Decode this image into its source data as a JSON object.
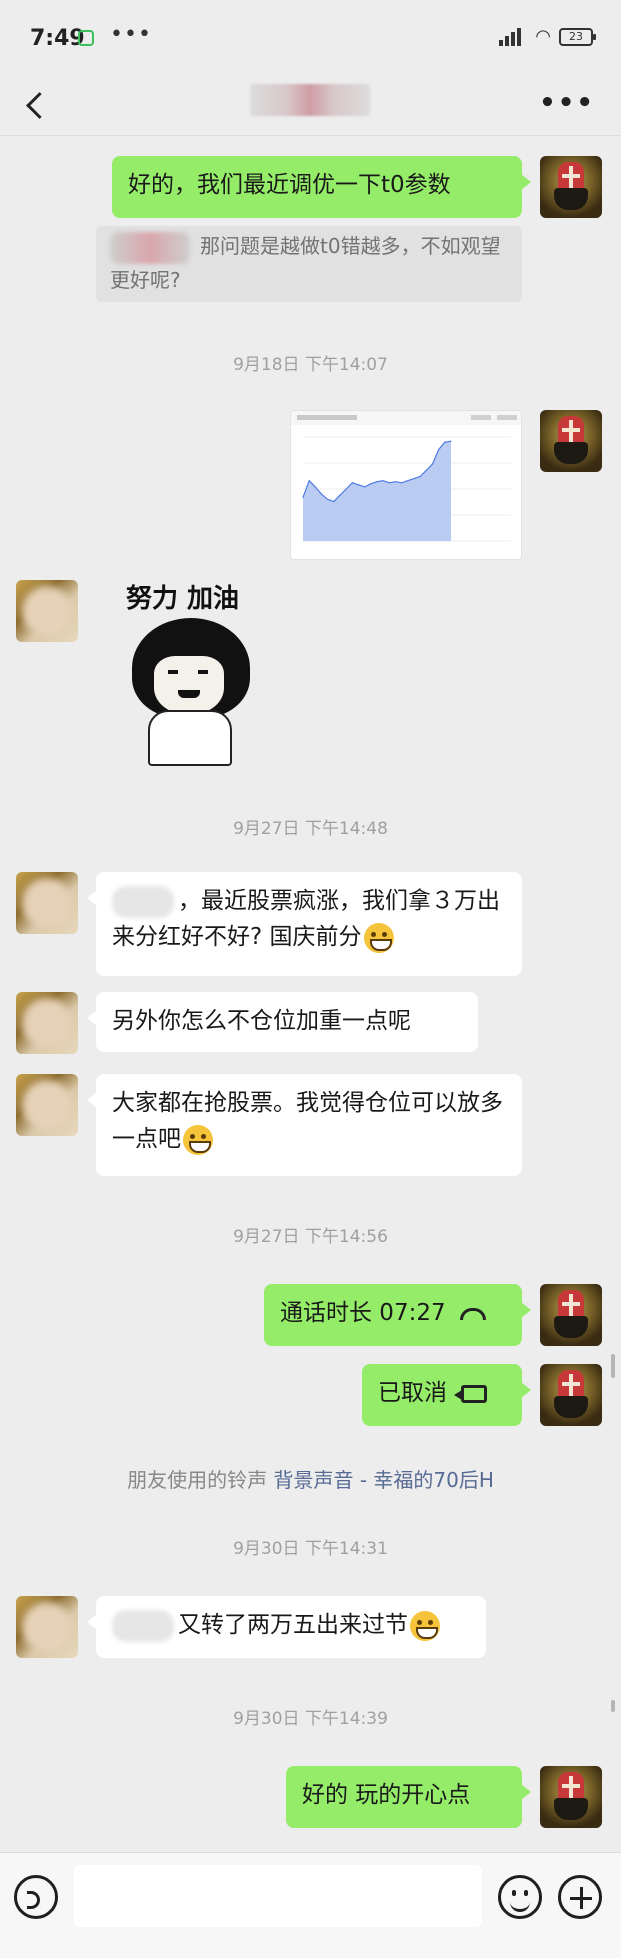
{
  "status_bar": {
    "time": "7:49",
    "battery": "23"
  },
  "messages": {
    "m1_text": "好的，我们最近调优一下t0参数",
    "m1_quote": "那问题是越做t0错越多，不如观望更好呢?",
    "ts1": "9月18日 下午14:07",
    "sticker_text": "努力 加油",
    "ts2": "9月27日 下午14:48",
    "m3_text": "，最近股票疯涨，我们拿３万出来分红好不好? 国庆前分",
    "m4_text": "另外你怎么不仓位加重一点呢",
    "m5_text": "大家都在抢股票。我觉得仓位可以放多一点吧",
    "ts3": "9月27日 下午14:56",
    "call_text": "通话时长 07:27",
    "cancel_text": "已取消",
    "ringtone_prefix": "朋友使用的铃声",
    "ringtone_link": "背景声音 - 幸福的70后H",
    "ts4": "9月30日 下午14:31",
    "m7_text": "又转了两万五出来过节",
    "ts5": "9月30日 下午14:39",
    "m8_text": "好的  玩的开心点"
  },
  "chart_data": {
    "type": "area",
    "title": "",
    "xlabel": "",
    "ylabel": "",
    "x": [
      0,
      1,
      2,
      3,
      4,
      5,
      6,
      7,
      8,
      9,
      10,
      11,
      12,
      13,
      14,
      15,
      16,
      17,
      18,
      19,
      20,
      21,
      22,
      23,
      24
    ],
    "values": [
      42,
      58,
      52,
      45,
      40,
      38,
      44,
      50,
      56,
      54,
      52,
      55,
      57,
      58,
      56,
      57,
      56,
      58,
      60,
      62,
      68,
      74,
      88,
      95,
      96
    ],
    "colors": {
      "fill": "#aabff0",
      "line": "#4f7be6"
    }
  }
}
